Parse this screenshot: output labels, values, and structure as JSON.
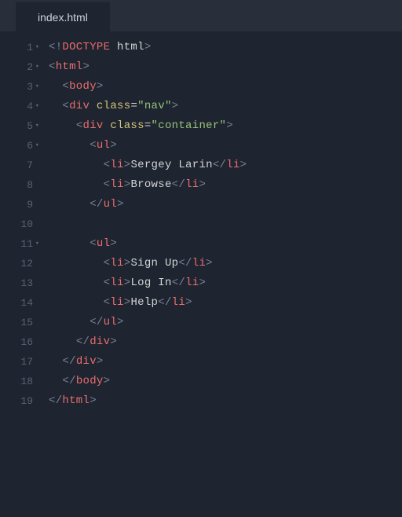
{
  "tab": {
    "filename": "index.html"
  },
  "code": {
    "lines": [
      {
        "num": 1,
        "fold": true,
        "indent": 0,
        "tokens": [
          {
            "c": "t-bracket",
            "t": "<!"
          },
          {
            "c": "t-doctype",
            "t": "DOCTYPE"
          },
          {
            "c": "t-doctype-kw",
            "t": " html"
          },
          {
            "c": "t-bracket",
            "t": ">"
          }
        ]
      },
      {
        "num": 2,
        "fold": true,
        "indent": 0,
        "tokens": [
          {
            "c": "t-bracket",
            "t": "<"
          },
          {
            "c": "t-tag",
            "t": "html"
          },
          {
            "c": "t-bracket",
            "t": ">"
          }
        ]
      },
      {
        "num": 3,
        "fold": true,
        "indent": 1,
        "tokens": [
          {
            "c": "t-bracket",
            "t": "<"
          },
          {
            "c": "t-tag",
            "t": "body"
          },
          {
            "c": "t-bracket",
            "t": ">"
          }
        ]
      },
      {
        "num": 4,
        "fold": true,
        "indent": 1,
        "tokens": [
          {
            "c": "t-bracket",
            "t": "<"
          },
          {
            "c": "t-tag",
            "t": "div"
          },
          {
            "c": "t-text",
            "t": " "
          },
          {
            "c": "t-attr-name",
            "t": "class"
          },
          {
            "c": "t-attr-eq",
            "t": "="
          },
          {
            "c": "t-attr-val",
            "t": "\"nav\""
          },
          {
            "c": "t-bracket",
            "t": ">"
          }
        ]
      },
      {
        "num": 5,
        "fold": true,
        "indent": 2,
        "tokens": [
          {
            "c": "t-bracket",
            "t": "<"
          },
          {
            "c": "t-tag",
            "t": "div"
          },
          {
            "c": "t-text",
            "t": " "
          },
          {
            "c": "t-attr-name",
            "t": "class"
          },
          {
            "c": "t-attr-eq",
            "t": "="
          },
          {
            "c": "t-attr-val",
            "t": "\"container\""
          },
          {
            "c": "t-bracket",
            "t": ">"
          }
        ]
      },
      {
        "num": 6,
        "fold": true,
        "indent": 3,
        "tokens": [
          {
            "c": "t-bracket",
            "t": "<"
          },
          {
            "c": "t-tag",
            "t": "ul"
          },
          {
            "c": "t-bracket",
            "t": ">"
          }
        ]
      },
      {
        "num": 7,
        "fold": false,
        "indent": 4,
        "tokens": [
          {
            "c": "t-bracket",
            "t": "<"
          },
          {
            "c": "t-tag",
            "t": "li"
          },
          {
            "c": "t-bracket",
            "t": ">"
          },
          {
            "c": "t-text",
            "t": "Sergey Larin"
          },
          {
            "c": "t-bracket",
            "t": "</"
          },
          {
            "c": "t-tag",
            "t": "li"
          },
          {
            "c": "t-bracket",
            "t": ">"
          }
        ]
      },
      {
        "num": 8,
        "fold": false,
        "indent": 4,
        "tokens": [
          {
            "c": "t-bracket",
            "t": "<"
          },
          {
            "c": "t-tag",
            "t": "li"
          },
          {
            "c": "t-bracket",
            "t": ">"
          },
          {
            "c": "t-text",
            "t": "Browse"
          },
          {
            "c": "t-bracket",
            "t": "</"
          },
          {
            "c": "t-tag",
            "t": "li"
          },
          {
            "c": "t-bracket",
            "t": ">"
          }
        ]
      },
      {
        "num": 9,
        "fold": false,
        "indent": 3,
        "tokens": [
          {
            "c": "t-bracket",
            "t": "</"
          },
          {
            "c": "t-tag",
            "t": "ul"
          },
          {
            "c": "t-bracket",
            "t": ">"
          }
        ]
      },
      {
        "num": 10,
        "fold": false,
        "indent": 0,
        "tokens": []
      },
      {
        "num": 11,
        "fold": true,
        "indent": 3,
        "tokens": [
          {
            "c": "t-bracket",
            "t": "<"
          },
          {
            "c": "t-tag",
            "t": "ul"
          },
          {
            "c": "t-bracket",
            "t": ">"
          }
        ]
      },
      {
        "num": 12,
        "fold": false,
        "indent": 4,
        "tokens": [
          {
            "c": "t-bracket",
            "t": "<"
          },
          {
            "c": "t-tag",
            "t": "li"
          },
          {
            "c": "t-bracket",
            "t": ">"
          },
          {
            "c": "t-text",
            "t": "Sign Up"
          },
          {
            "c": "t-bracket",
            "t": "</"
          },
          {
            "c": "t-tag",
            "t": "li"
          },
          {
            "c": "t-bracket",
            "t": ">"
          }
        ]
      },
      {
        "num": 13,
        "fold": false,
        "indent": 4,
        "tokens": [
          {
            "c": "t-bracket",
            "t": "<"
          },
          {
            "c": "t-tag",
            "t": "li"
          },
          {
            "c": "t-bracket",
            "t": ">"
          },
          {
            "c": "t-text",
            "t": "Log In"
          },
          {
            "c": "t-bracket",
            "t": "</"
          },
          {
            "c": "t-tag",
            "t": "li"
          },
          {
            "c": "t-bracket",
            "t": ">"
          }
        ]
      },
      {
        "num": 14,
        "fold": false,
        "indent": 4,
        "tokens": [
          {
            "c": "t-bracket",
            "t": "<"
          },
          {
            "c": "t-tag",
            "t": "li"
          },
          {
            "c": "t-bracket",
            "t": ">"
          },
          {
            "c": "t-text",
            "t": "Help"
          },
          {
            "c": "t-bracket",
            "t": "</"
          },
          {
            "c": "t-tag",
            "t": "li"
          },
          {
            "c": "t-bracket",
            "t": ">"
          }
        ]
      },
      {
        "num": 15,
        "fold": false,
        "indent": 3,
        "tokens": [
          {
            "c": "t-bracket",
            "t": "</"
          },
          {
            "c": "t-tag",
            "t": "ul"
          },
          {
            "c": "t-bracket",
            "t": ">"
          }
        ]
      },
      {
        "num": 16,
        "fold": false,
        "indent": 2,
        "tokens": [
          {
            "c": "t-bracket",
            "t": "</"
          },
          {
            "c": "t-tag",
            "t": "div"
          },
          {
            "c": "t-bracket",
            "t": ">"
          }
        ]
      },
      {
        "num": 17,
        "fold": false,
        "indent": 1,
        "tokens": [
          {
            "c": "t-bracket",
            "t": "</"
          },
          {
            "c": "t-tag",
            "t": "div"
          },
          {
            "c": "t-bracket",
            "t": ">"
          }
        ]
      },
      {
        "num": 18,
        "fold": false,
        "indent": 1,
        "tokens": [
          {
            "c": "t-bracket",
            "t": "</"
          },
          {
            "c": "t-tag",
            "t": "body"
          },
          {
            "c": "t-bracket",
            "t": ">"
          }
        ]
      },
      {
        "num": 19,
        "fold": false,
        "indent": 0,
        "tokens": [
          {
            "c": "t-bracket",
            "t": "</"
          },
          {
            "c": "t-tag",
            "t": "html"
          },
          {
            "c": "t-bracket",
            "t": ">"
          }
        ]
      }
    ]
  }
}
